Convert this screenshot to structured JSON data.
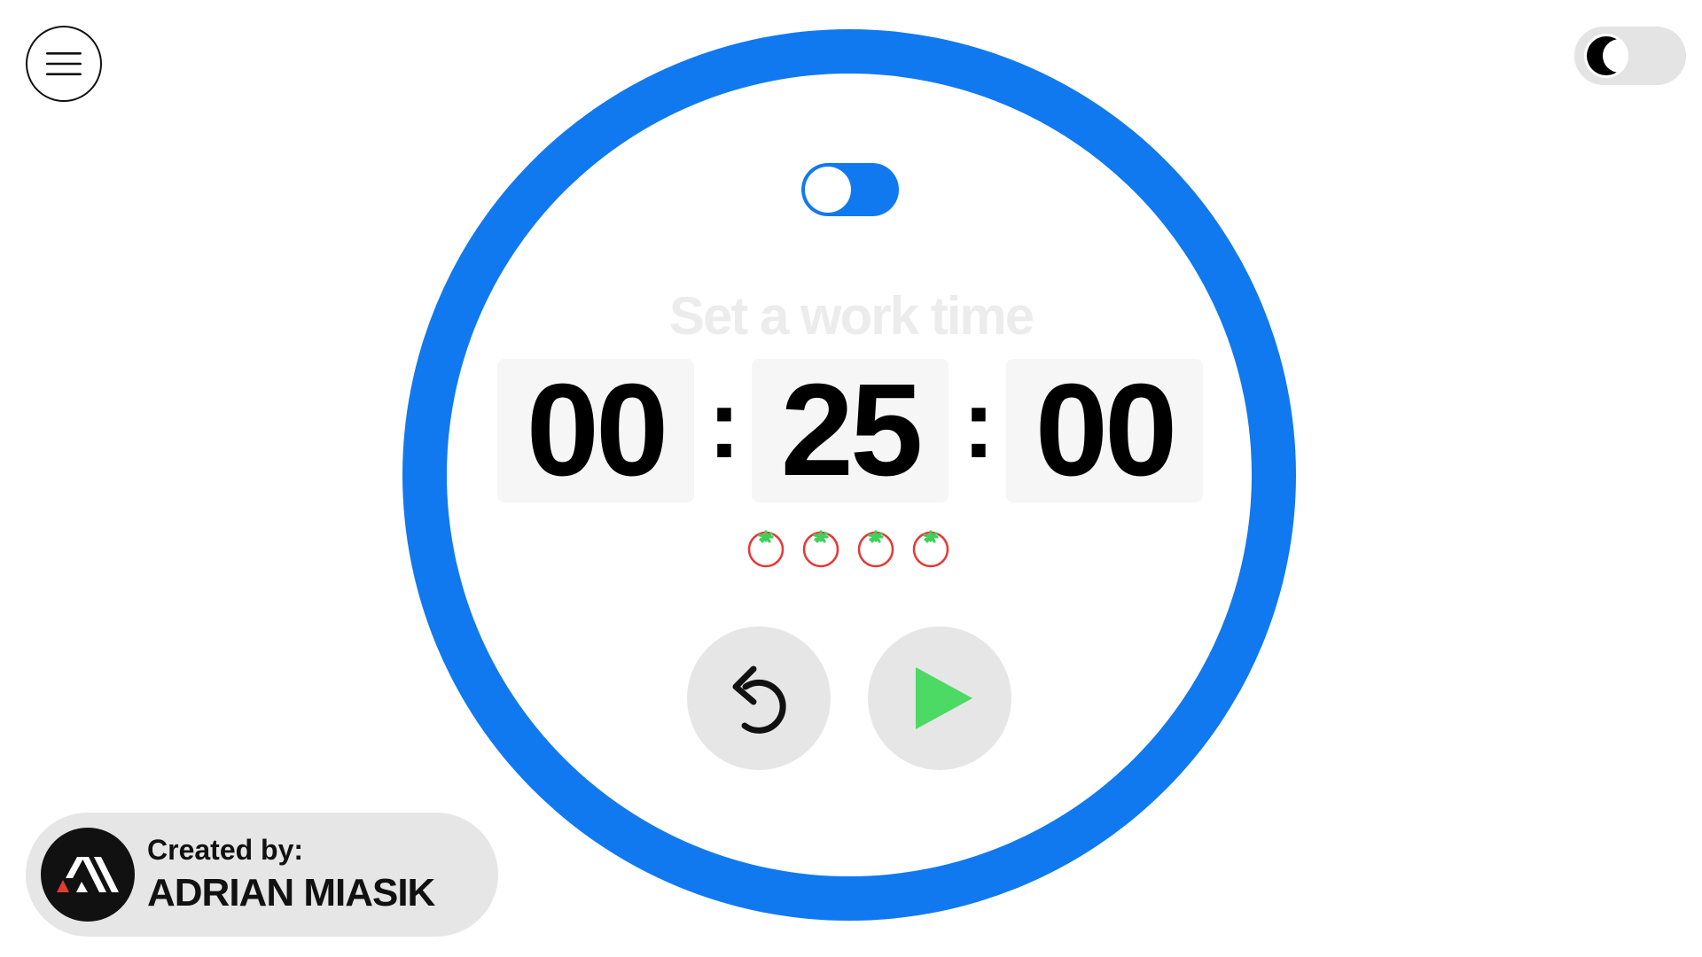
{
  "menu": {
    "icon": "hamburger-menu-icon"
  },
  "theme": {
    "mode": "light",
    "icon": "moon-icon"
  },
  "mode_switch": {
    "state": "off"
  },
  "timer": {
    "prompt": "Set a work time",
    "hours": "00",
    "minutes": "25",
    "seconds": "00",
    "separator": ":"
  },
  "sessions": {
    "count": 4,
    "icon": "tomato-icon"
  },
  "controls": {
    "reset_icon": "reset-icon",
    "play_icon": "play-icon"
  },
  "credit": {
    "label": "Created by:",
    "name": "ADRIAN MIASIK",
    "logo_icon": "am-logo-icon"
  },
  "colors": {
    "ring": "#1179ef",
    "play": "#4cd964",
    "tomato_body": "#e53935",
    "tomato_leaf": "#3ecf5c",
    "button_bg": "#e6e6e6",
    "time_box_bg": "#f6f6f6"
  }
}
